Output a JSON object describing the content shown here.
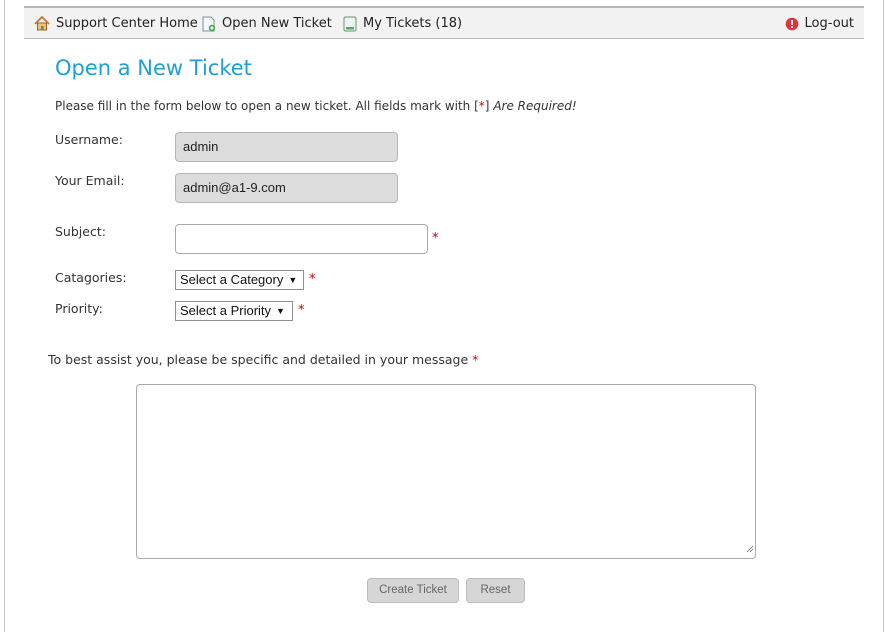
{
  "nav": {
    "home": {
      "label": "Support Center Home",
      "icon": "home-icon"
    },
    "new_ticket": {
      "label": "Open New Ticket",
      "icon": "new-ticket-icon"
    },
    "my_tickets": {
      "label": "My Tickets (18)",
      "icon": "my-tickets-icon"
    },
    "logout": {
      "label": "Log-out",
      "icon": "logout-icon"
    }
  },
  "page": {
    "title": "Open a New Ticket",
    "intro_text": "Please fill in the form below to open a new ticket. All fields mark with [",
    "intro_star": "*",
    "intro_bracket": "]",
    "intro_required": "Are Required!"
  },
  "form": {
    "username_label": "Username:",
    "username_value": "admin",
    "email_label": "Your Email:",
    "email_value": "admin@a1-9.com",
    "subject_label": "Subject:",
    "subject_value": "",
    "category_label": "Catagories:",
    "category_selected": "Select a Category",
    "priority_label": "Priority:",
    "priority_selected": "Select a Priority",
    "required_marker": "*",
    "message_label": "To best assist you, please be specific and detailed in your message",
    "message_value": "",
    "create_button": "Create Ticket",
    "reset_button": "Reset"
  },
  "colors": {
    "title": "#1e9fd3",
    "required": "#cc0000",
    "navbar_bg": "#f2f2f2",
    "readonly_bg": "#dcdcdc",
    "button_bg": "#d6d6d6"
  }
}
